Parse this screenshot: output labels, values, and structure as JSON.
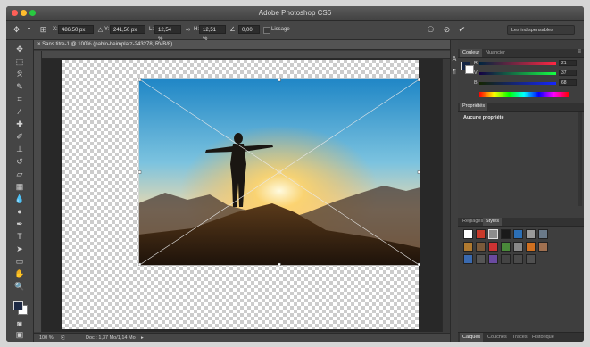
{
  "app": {
    "title": "Adobe Photoshop CS6"
  },
  "options_bar": {
    "x_label": "X:",
    "x_value": "486,50 px",
    "y_label": "Y:",
    "y_value": "241,50 px",
    "w_label": "L:",
    "w_value": "12,54 %",
    "h_label": "H:",
    "h_value": "12,51 %",
    "angle_value": "0,00",
    "smoothing_label": "Lissage",
    "workspace": "Les indispensables"
  },
  "document": {
    "tab_title": "Sans titre-1 @ 100% (pablo-heimplatz-243278, RVB/8)",
    "zoom": "100 %",
    "doc_info": "Doc : 1,37 Mo/1,14 Mo"
  },
  "panels": {
    "color": {
      "tabs": [
        "Couleur",
        "Nuancier"
      ],
      "r_label": "R",
      "r_value": "21",
      "v_label": "V",
      "v_value": "37",
      "b_label": "B",
      "b_value": "68"
    },
    "properties": {
      "title": "Propriétés",
      "empty_text": "Aucune propriété"
    },
    "styles": {
      "tabs": [
        "Réglages",
        "Styles"
      ]
    },
    "bottom_tabs": [
      "Calques",
      "Couches",
      "Tracés",
      "Historique"
    ]
  },
  "colors": {
    "foreground": "#15254 4",
    "accent": "#4a90d9"
  }
}
